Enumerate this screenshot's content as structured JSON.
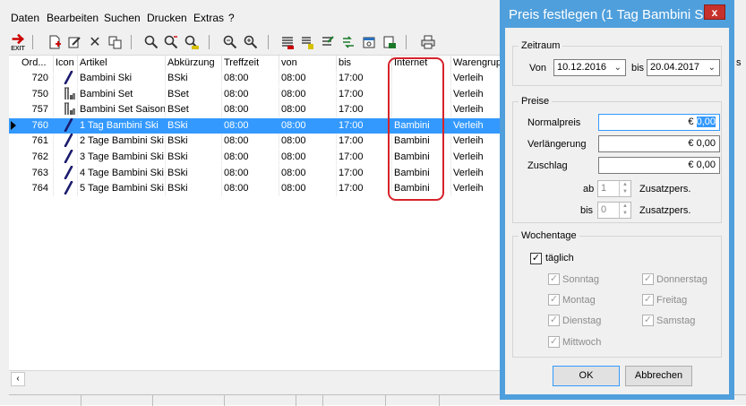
{
  "menu": [
    "Daten",
    "Bearbeiten",
    "Suchen",
    "Drucken",
    "Extras",
    "?"
  ],
  "toolbar": {
    "exit_label": "EXIT"
  },
  "grid": {
    "headers": [
      "Ord...",
      "Icon",
      "Artikel",
      "Abkürzung",
      "Treffzeit",
      "von",
      "bis",
      "Internet",
      "Warengrup"
    ],
    "rows": [
      {
        "ord": "720",
        "icon": "ski-icon",
        "artikel": "Bambini Ski",
        "abk": "BSki",
        "treff": "08:00",
        "von": "08:00",
        "bis": "17:00",
        "internet": "",
        "waren": "Verleih",
        "selected": false
      },
      {
        "ord": "750",
        "icon": "ski-set-icon",
        "artikel": "Bambini Set",
        "abk": "BSet",
        "treff": "08:00",
        "von": "08:00",
        "bis": "17:00",
        "internet": "",
        "waren": "Verleih",
        "selected": false
      },
      {
        "ord": "757",
        "icon": "ski-set-icon",
        "artikel": "Bambini Set Saison",
        "abk": "BSet",
        "treff": "08:00",
        "von": "08:00",
        "bis": "17:00",
        "internet": "",
        "waren": "Verleih",
        "selected": false
      },
      {
        "ord": "760",
        "icon": "ski-icon",
        "artikel": "1 Tag Bambini Ski",
        "abk": "BSki",
        "treff": "08:00",
        "von": "08:00",
        "bis": "17:00",
        "internet": "Bambini",
        "waren": "Verleih",
        "selected": true
      },
      {
        "ord": "761",
        "icon": "ski-icon",
        "artikel": "2 Tage Bambini Ski",
        "abk": "BSki",
        "treff": "08:00",
        "von": "08:00",
        "bis": "17:00",
        "internet": "Bambini",
        "waren": "Verleih",
        "selected": false
      },
      {
        "ord": "762",
        "icon": "ski-icon",
        "artikel": "3 Tage Bambini Ski",
        "abk": "BSki",
        "treff": "08:00",
        "von": "08:00",
        "bis": "17:00",
        "internet": "Bambini",
        "waren": "Verleih",
        "selected": false
      },
      {
        "ord": "763",
        "icon": "ski-icon",
        "artikel": "4 Tage Bambini Ski",
        "abk": "BSki",
        "treff": "08:00",
        "von": "08:00",
        "bis": "17:00",
        "internet": "Bambini",
        "waren": "Verleih",
        "selected": false
      },
      {
        "ord": "764",
        "icon": "ski-icon",
        "artikel": "5 Tage Bambini Ski",
        "abk": "BSki",
        "treff": "08:00",
        "von": "08:00",
        "bis": "17:00",
        "internet": "Bambini",
        "waren": "Verleih",
        "selected": false
      }
    ],
    "right_edge_header_fragment": "s"
  },
  "dialog": {
    "title": "Preis festlegen (1 Tag Bambini S...",
    "close_label": "x",
    "zeitraum": {
      "legend": "Zeitraum",
      "von_label": "Von",
      "von_value": "10.12.2016",
      "bis_label": "bis",
      "bis_value": "20.04.2017"
    },
    "preise": {
      "legend": "Preise",
      "normalpreis_label": "Normalpreis",
      "normalpreis_prefix": "€ ",
      "normalpreis_selected": "0,00",
      "verlaengerung_label": "Verlängerung",
      "verlaengerung_value": "€ 0,00",
      "zuschlag_label": "Zuschlag",
      "zuschlag_value": "€ 0,00",
      "ab_label": "ab",
      "ab_value": "1",
      "bis_label": "bis",
      "bis_value": "0",
      "zusatz_label": "Zusatzpers."
    },
    "wochentage": {
      "legend": "Wochentage",
      "taeglich": "täglich",
      "days_left": [
        "Sonntag",
        "Montag",
        "Dienstag",
        "Mittwoch"
      ],
      "days_right": [
        "Donnerstag",
        "Freitag",
        "Samstag"
      ]
    },
    "ok_label": "OK",
    "cancel_label": "Abbrechen"
  },
  "colors": {
    "selection": "#3399ff",
    "dialog_frame": "#4f9fdc",
    "highlight": "#d6232b",
    "close": "#c7312b"
  }
}
